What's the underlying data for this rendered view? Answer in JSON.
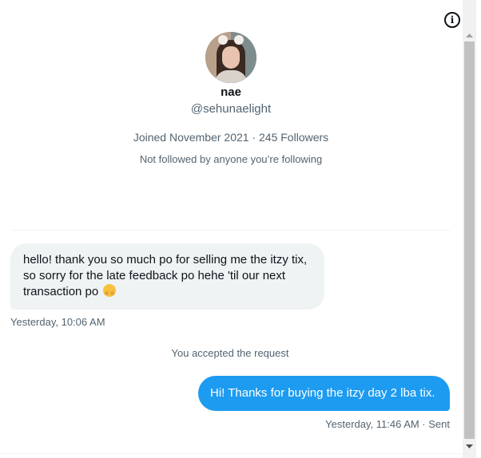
{
  "profile": {
    "name": "nae",
    "handle": "@sehunaelight",
    "meta": "Joined November 2021 · 245 Followers",
    "followed_by": "Not followed by anyone you’re following"
  },
  "icons": {
    "info": "info-icon",
    "avatar": "profile-avatar",
    "emoji": "hugging-face-emoji"
  },
  "messages": {
    "incoming": {
      "text": "hello! thank you so much po for selling me the itzy tix, so sorry for the late feedback po hehe 'til our next transaction po ",
      "timestamp": "Yesterday, 10:06 AM"
    },
    "system": "You accepted the request",
    "outgoing": {
      "text": "Hi! Thanks for buying the itzy day 2 lba tix.",
      "timestamp": "Yesterday, 11:46 AM · Sent"
    }
  },
  "colors": {
    "accent": "#1d9bf0",
    "incoming_bubble": "#eff3f4",
    "secondary_text": "#536471",
    "primary_text": "#0f1419"
  }
}
